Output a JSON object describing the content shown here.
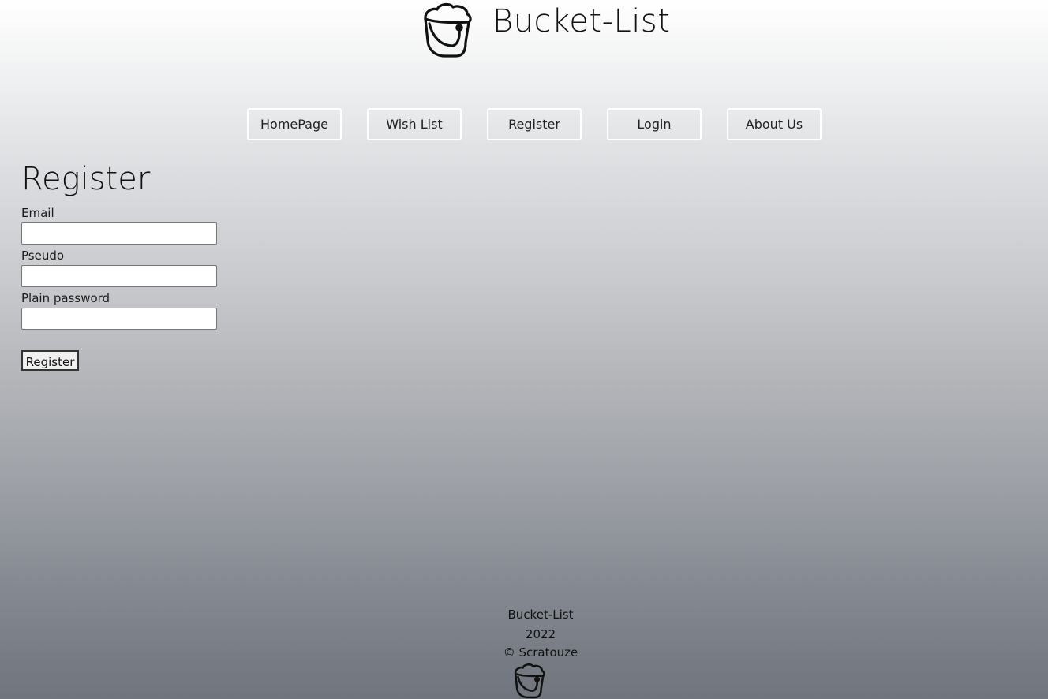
{
  "header": {
    "title": "Bucket-List",
    "logo_icon": "bucket-icon"
  },
  "nav": {
    "items": [
      {
        "label": "HomePage"
      },
      {
        "label": "Wish List"
      },
      {
        "label": "Register"
      },
      {
        "label": "Login"
      },
      {
        "label": "About Us"
      }
    ]
  },
  "form": {
    "title": "Register",
    "email_label": "Email",
    "email_value": "",
    "pseudo_label": "Pseudo",
    "pseudo_value": "",
    "password_label": "Plain password",
    "password_value": "",
    "submit_label": "Register"
  },
  "footer": {
    "name": "Bucket-List",
    "year": "2022",
    "copyright": "© Scratouze",
    "logo_icon": "bucket-icon"
  }
}
